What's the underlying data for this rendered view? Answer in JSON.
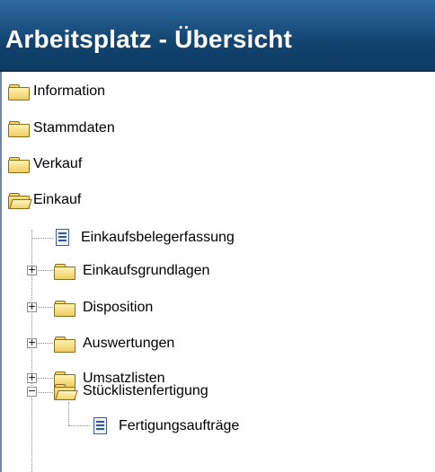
{
  "window": {
    "title": "Arbeitsplatz - Übersicht"
  },
  "tree": {
    "items": [
      {
        "label": "Information",
        "icon": "folder-icon"
      },
      {
        "label": "Stammdaten",
        "icon": "folder-icon"
      },
      {
        "label": "Verkauf",
        "icon": "folder-icon"
      },
      {
        "label": "Einkauf",
        "icon": "folder-open-icon",
        "expanded": true,
        "children": [
          {
            "label": "Einkaufsbelegerfassung",
            "icon": "document-icon"
          },
          {
            "label": "Einkaufsgrundlagen",
            "icon": "folder-icon",
            "expander": "+"
          },
          {
            "label": "Disposition",
            "icon": "folder-icon",
            "expander": "+"
          },
          {
            "label": "Auswertungen",
            "icon": "folder-icon",
            "expander": "+"
          },
          {
            "label": "Umsatzlisten",
            "icon": "folder-icon",
            "expander": "+"
          },
          {
            "label": "Stücklistenfertigung",
            "icon": "folder-open-icon",
            "expander": "−",
            "expanded": true,
            "children": [
              {
                "label": "Fertigungsaufträge",
                "icon": "document-icon"
              }
            ]
          }
        ]
      }
    ]
  },
  "colors": {
    "title_bar": "#1a4d7c",
    "title_text": "#ffffff",
    "folder": "#f2d774",
    "document": "#2d57a5"
  }
}
